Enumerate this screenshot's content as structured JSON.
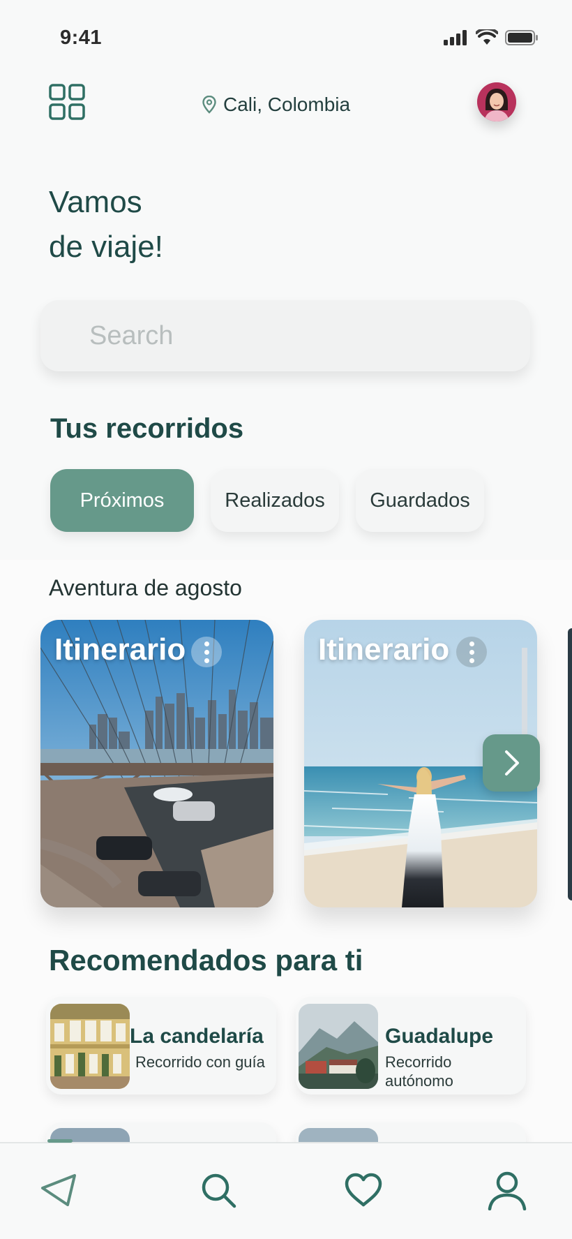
{
  "status_bar": {
    "time": "9:41"
  },
  "header": {
    "location": "Cali, Colombia"
  },
  "greeting": {
    "line1": "Vamos",
    "line2": "de viaje!"
  },
  "search": {
    "placeholder": "Search"
  },
  "trips": {
    "title": "Tus recorridos",
    "tabs": [
      {
        "label": "Próximos",
        "active": true
      },
      {
        "label": "Realizados",
        "active": false
      },
      {
        "label": "Guardados",
        "active": false
      }
    ],
    "group_label": "Aventura de agosto",
    "cards": [
      {
        "title": "Itinerario",
        "image": "city-bridge-photo"
      },
      {
        "title": "Itinerario",
        "image": "beach-woman-photo"
      }
    ]
  },
  "recommended": {
    "title": "Recomendados para ti",
    "items": [
      {
        "name": "La candelaría",
        "subtitle": "Recorrido con guía",
        "image": "colonial-building-photo"
      },
      {
        "name": "Guadalupe",
        "subtitle_line1": "Recorrido",
        "subtitle_line2": "autónomo",
        "image": "mountain-town-photo"
      }
    ]
  },
  "tabbar": {
    "items": [
      "navigation-icon",
      "search-icon",
      "heart-icon",
      "profile-icon"
    ],
    "active": "navigation-icon"
  },
  "colors": {
    "accent": "#66998a",
    "text_primary": "#1f4a47",
    "background": "#f8f9f9"
  }
}
